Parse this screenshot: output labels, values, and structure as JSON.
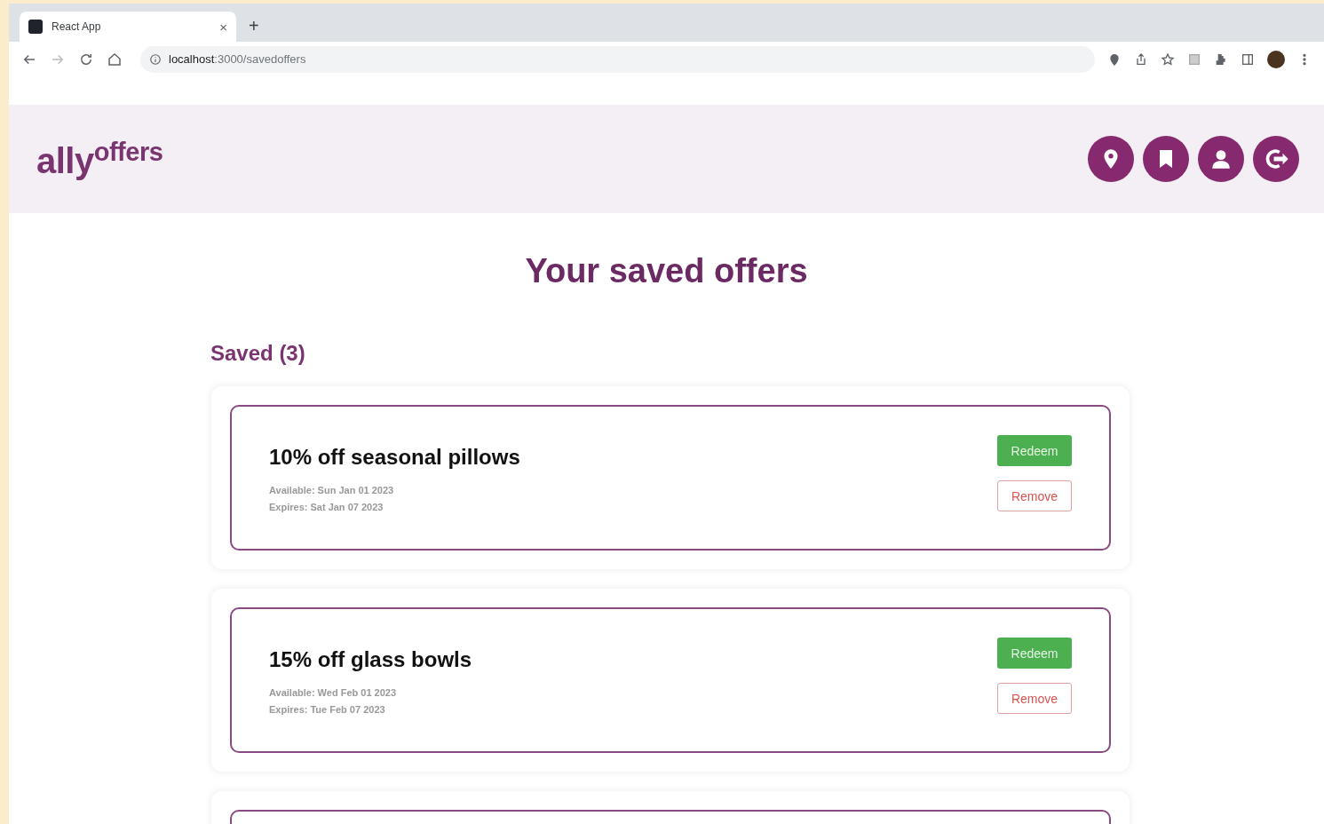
{
  "browser": {
    "tab_title": "React App",
    "tab_close": "×",
    "new_tab": "+",
    "url_host": "localhost",
    "url_path": ":3000/savedoffers"
  },
  "header": {
    "logo_main": "ally",
    "logo_sup": "offers"
  },
  "page_title": "Your saved offers",
  "saved_heading": "Saved (3)",
  "offers": [
    {
      "title": "10% off seasonal pillows",
      "available": "Available: Sun Jan 01 2023",
      "expires": "Expires: Sat Jan 07 2023",
      "redeem": "Redeem",
      "remove": "Remove"
    },
    {
      "title": "15% off glass bowls",
      "available": "Available: Wed Feb 01 2023",
      "expires": "Expires: Tue Feb 07 2023",
      "redeem": "Redeem",
      "remove": "Remove"
    }
  ],
  "more_card_below": true
}
